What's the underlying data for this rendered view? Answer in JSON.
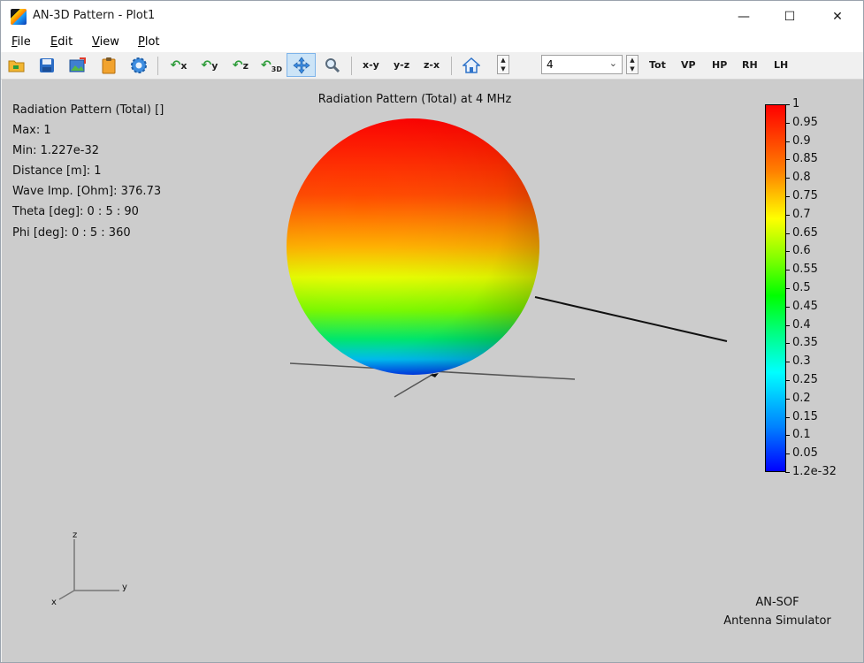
{
  "window": {
    "title": "AN-3D Pattern - Plot1",
    "controls": {
      "minimize": "—",
      "maximize": "☐",
      "close": "✕"
    }
  },
  "menu": {
    "file": {
      "accel": "F",
      "rest": "ile"
    },
    "edit": {
      "accel": "E",
      "rest": "dit"
    },
    "view": {
      "accel": "V",
      "rest": "iew"
    },
    "plot": {
      "accel": "P",
      "rest": "lot"
    }
  },
  "toolbar": {
    "icons": {
      "open": "folder-open-icon",
      "save": "save-icon",
      "export": "image-export-icon",
      "clipboard": "clipboard-icon",
      "settings": "gear-icon",
      "rotate_x": "rotate-x-icon",
      "rotate_y": "rotate-y-icon",
      "rotate_z": "rotate-z-icon",
      "rotate_3d": "rotate-3d-icon",
      "pan": "pan-icon",
      "zoom": "zoom-icon",
      "home": "home-icon"
    },
    "rotate_x_label": "x",
    "rotate_y_label": "y",
    "rotate_z_label": "z",
    "rotate_3d_label": "3D",
    "view_xy": "x-y",
    "view_yz": "y-z",
    "view_zx": "z-x",
    "freq_value": "4",
    "pol_tot": "Tot",
    "pol_vp": "VP",
    "pol_hp": "HP",
    "pol_rh": "RH",
    "pol_lh": "LH"
  },
  "plot": {
    "title": "Radiation Pattern (Total) at 4 MHz",
    "info": [
      "Radiation Pattern (Total) []",
      "Max: 1",
      "Min: 1.227e-32",
      "Distance [m]: 1",
      "Wave Imp. [Ohm]: 376.73",
      "Theta [deg]: 0 : 5 : 90",
      "Phi [deg]: 0 : 5 : 360"
    ],
    "colorbar_labels": [
      "1",
      "0.95",
      "0.9",
      "0.85",
      "0.8",
      "0.75",
      "0.7",
      "0.65",
      "0.6",
      "0.55",
      "0.5",
      "0.45",
      "0.4",
      "0.35",
      "0.3",
      "0.25",
      "0.2",
      "0.15",
      "0.1",
      "0.05",
      "1.2e-32"
    ],
    "triad": {
      "z": "z",
      "y": "y",
      "x": "x"
    },
    "brand_line1": "AN-SOF",
    "brand_line2": "Antenna Simulator"
  },
  "colors": {
    "plot_bg": "#cccccc",
    "active_tool_bg": "#cce4f7",
    "colormap_low": "#0000ff",
    "colormap_high": "#ff0000"
  }
}
